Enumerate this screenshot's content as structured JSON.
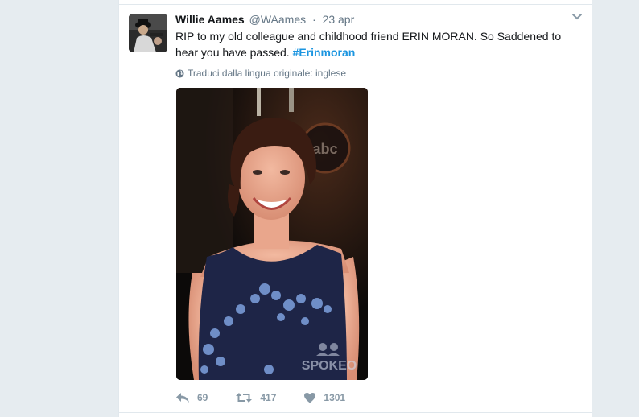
{
  "tweet": {
    "author_name": "Willie Aames",
    "author_handle": "@WAames",
    "separator": "·",
    "timestamp": "23 apr",
    "text_plain": "RIP to my old colleague and childhood friend ERIN MORAN. So Saddened to hear you have passed. ",
    "hashtag": "#Erinmoran",
    "translate_label": "Traduci dalla lingua originale: inglese",
    "photo": {
      "watermark": "SPOKEO",
      "logo_text": "abc"
    },
    "actions": {
      "reply_count": "69",
      "retweet_count": "417",
      "like_count": "1301"
    }
  },
  "colors": {
    "page_background": "#e6ecf0",
    "link": "#1b95e0",
    "muted": "#657786",
    "action_icon": "#8899a6"
  },
  "icons": {
    "reply": "reply-icon",
    "retweet": "retweet-icon",
    "like": "heart-icon",
    "more": "chevron-down-icon",
    "translate": "globe-icon"
  }
}
